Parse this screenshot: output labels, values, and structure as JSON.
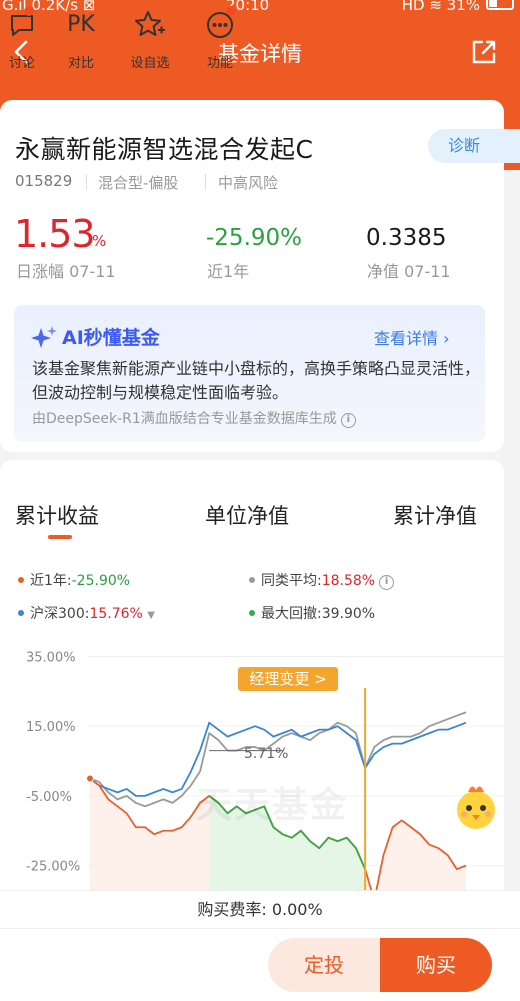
{
  "status_bar": {
    "signal": "G",
    "speed": "0.2K/s",
    "time": "20:10",
    "network": "HD",
    "battery": "31%"
  },
  "nav": {
    "title": "基金详情"
  },
  "fund": {
    "name": "永赢新能源智选混合发起C",
    "diagnose_label": "诊断",
    "code": "015829",
    "type": "混合型-偏股",
    "risk": "中高风险"
  },
  "stats": {
    "day_change": "1.53",
    "day_change_unit": "%",
    "day_label": "日涨幅 07-11",
    "year_change": "-25.90%",
    "year_label": "近1年",
    "nav_value": "0.3385",
    "nav_label": "净值 07-11"
  },
  "ai": {
    "title": "AI秒懂基金",
    "link": "查看详情 ›",
    "text": "该基金聚焦新能源产业链中小盘标的，高换手策略凸显灵活性，但波动控制与规模稳定性面临考验。",
    "source": "由DeepSeek-R1满血版结合专业基金数据库生成"
  },
  "chart_tabs": [
    "累计收益",
    "单位净值",
    "累计净值"
  ],
  "legend": {
    "fund_label": "近1年:",
    "fund_value": "-25.90%",
    "peer_label": "同类平均:",
    "peer_value": "18.58%",
    "index_label": "沪深300:",
    "index_value": "15.76%",
    "drawdown_label": "最大回撤:",
    "drawdown_value": "39.90%"
  },
  "chart_data": {
    "type": "line",
    "ylim": [
      -32,
      38
    ],
    "yticks": [
      "35.00%",
      "15.00%",
      "-5.00%",
      "-25.00%"
    ],
    "ytick_values": [
      35,
      15,
      -5,
      -25
    ],
    "series": [
      {
        "name": "近1年",
        "color": "#e8602c",
        "values": [
          0,
          -2,
          -6,
          -8,
          -10,
          -14,
          -14,
          -16,
          -15,
          -15,
          -14,
          -11,
          -7,
          -5,
          -7,
          -10,
          -8,
          -10,
          -9,
          -8,
          -14,
          -16,
          -17,
          -15,
          -18,
          -20,
          -17,
          -18,
          -17,
          -20,
          -26,
          -35,
          -22,
          -14,
          -12,
          -14,
          -16,
          -19,
          -20,
          -22,
          -26,
          -25
        ]
      },
      {
        "name": "同类平均",
        "color": "#9a9a9a",
        "values": [
          0,
          -1,
          -4,
          -6,
          -5,
          -7,
          -8,
          -7,
          -6,
          -7,
          -5,
          -2,
          2,
          13,
          11,
          8,
          8,
          9,
          9,
          8,
          10,
          12,
          13,
          12,
          11,
          13,
          14,
          16,
          15,
          13,
          3,
          9,
          11,
          12,
          12,
          12,
          13,
          15,
          16,
          17,
          18,
          19
        ]
      },
      {
        "name": "沪深300",
        "color": "#3a86d6",
        "values": [
          0,
          -2,
          -3,
          -4,
          -3,
          -5,
          -5,
          -4,
          -3,
          -4,
          -3,
          2,
          8,
          16,
          14,
          12,
          13,
          14,
          15,
          14,
          12,
          13,
          14,
          12,
          13,
          14,
          14,
          15,
          13,
          11,
          3,
          7,
          9,
          10,
          10,
          11,
          12,
          13,
          14,
          14,
          15,
          16
        ]
      }
    ],
    "annotations": {
      "manager_change": "经理变更 >",
      "point_value": "5.71%"
    }
  },
  "watermark": "天天基金",
  "fee": "购买费率: 0.00%",
  "bottom_nav": [
    "讨论",
    "对比",
    "设自选",
    "功能"
  ],
  "bottom_pk": "PK",
  "buttons": {
    "dingtou": "定投",
    "buy": "购买"
  }
}
